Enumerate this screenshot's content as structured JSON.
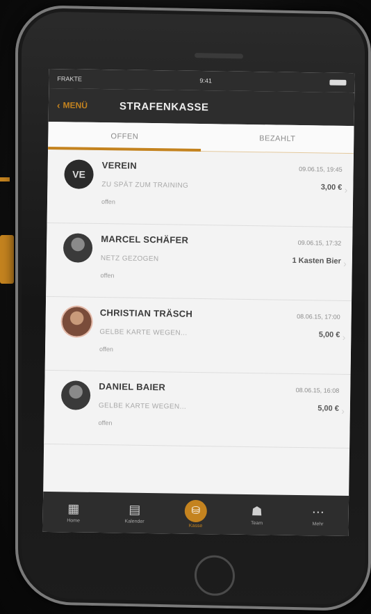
{
  "status_bar": {
    "carrier": "FRAKTE",
    "time": "9:41"
  },
  "nav": {
    "back_label": "MENÜ",
    "title": "STRAFENKASSE"
  },
  "tabs": [
    {
      "label": "OFFEN",
      "active": true
    },
    {
      "label": "BEZAHLT",
      "active": false
    }
  ],
  "items": [
    {
      "avatar": "team-logo",
      "initials": "VE",
      "name": "VEREIN",
      "date": "09.06.15, 19:45",
      "description": "ZU SPÄT ZUM TRAINING",
      "amount": "3,00 €",
      "status": "offen"
    },
    {
      "avatar": "photo",
      "name": "MARCEL SCHÄFER",
      "date": "09.06.15, 17:32",
      "description": "NETZ GEZOGEN",
      "amount": "1 Kasten Bier",
      "status": "offen"
    },
    {
      "avatar": "photo-warm",
      "name": "CHRISTIAN TRÄSCH",
      "date": "08.06.15, 17:00",
      "description": "GELBE KARTE WEGEN...",
      "amount": "5,00 €",
      "status": "offen"
    },
    {
      "avatar": "photo",
      "name": "DANIEL BAIER",
      "date": "08.06.15, 16:08",
      "description": "GELBE KARTE WEGEN...",
      "amount": "5,00 €",
      "status": "offen"
    }
  ],
  "tab_bar": [
    {
      "icon": "grid-icon",
      "glyph": "▦",
      "label": "Home"
    },
    {
      "icon": "news-icon",
      "glyph": "▤",
      "label": "Kalender"
    },
    {
      "icon": "piggybank-icon",
      "glyph": "⛁",
      "label": "Kasse",
      "active": true
    },
    {
      "icon": "team-icon",
      "glyph": "☗",
      "label": "Team"
    },
    {
      "icon": "more-icon",
      "glyph": "⋯",
      "label": "Mehr"
    }
  ],
  "colors": {
    "accent": "#c4831f",
    "bar": "#2d2d2d",
    "background": "#f3f3f3"
  }
}
